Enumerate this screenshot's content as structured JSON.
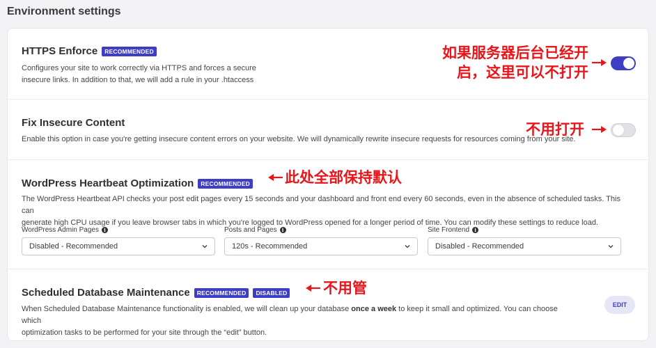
{
  "page": {
    "title": "Environment settings"
  },
  "sections": {
    "https": {
      "title": "HTTPS Enforce",
      "badge": "RECOMMENDED",
      "desc1": "Configures your site to work correctly via HTTPS and forces a secure",
      "desc2": "insecure links. In addition to that, we will add a rule in your .htaccess",
      "toggle_state": "on"
    },
    "insecure": {
      "title": "Fix Insecure Content",
      "desc1": "Enable this option in case you're getting insecure content errors on your website. We will dynamically rewrite insecure requests for resources coming from your site.",
      "toggle_state": "off"
    },
    "heartbeat": {
      "title": "WordPress Heartbeat Optimization",
      "badge": "RECOMMENDED",
      "desc1": "The WordPress Heartbeat API checks your post edit pages every 15 seconds and your dashboard and front end every 60 seconds, even in the absence of scheduled tasks. This can",
      "desc2": "generate high CPU usage if you leave browser tabs in which you're logged to WordPress opened for a longer period of time. You can modify these settings to reduce load.",
      "fields": [
        {
          "label": "WordPress Admin Pages",
          "value": "Disabled - Recommended"
        },
        {
          "label": "Posts and Pages",
          "value": "120s - Recommended"
        },
        {
          "label": "Site Frontend",
          "value": "Disabled - Recommended"
        }
      ]
    },
    "database": {
      "title": "Scheduled Database Maintenance",
      "badge1": "RECOMMENDED",
      "badge2": "DISABLED",
      "desc1_pre": "When Scheduled Database Maintenance functionality is enabled, we will clean up your database ",
      "desc1_bold": "once a week",
      "desc1_post": " to keep it small and optimized. You can choose which",
      "desc2": "optimization tasks to be performed for your site through the “edit” button.",
      "edit_label": "EDIT"
    }
  },
  "annotations": {
    "https_line1": "如果服务器后台已经开",
    "https_line2": "启，这里可以不打开",
    "insecure": "不用打开",
    "heartbeat": "此处全部保持默认",
    "database": "不用管"
  },
  "colors": {
    "accent": "#3e3ec4",
    "annotation": "#e8151b"
  },
  "icons": {
    "info": "info-icon",
    "select_chevron": "chevron-down-icon",
    "arrow_left": "arrow-left-icon",
    "arrow_right": "arrow-right-icon"
  }
}
